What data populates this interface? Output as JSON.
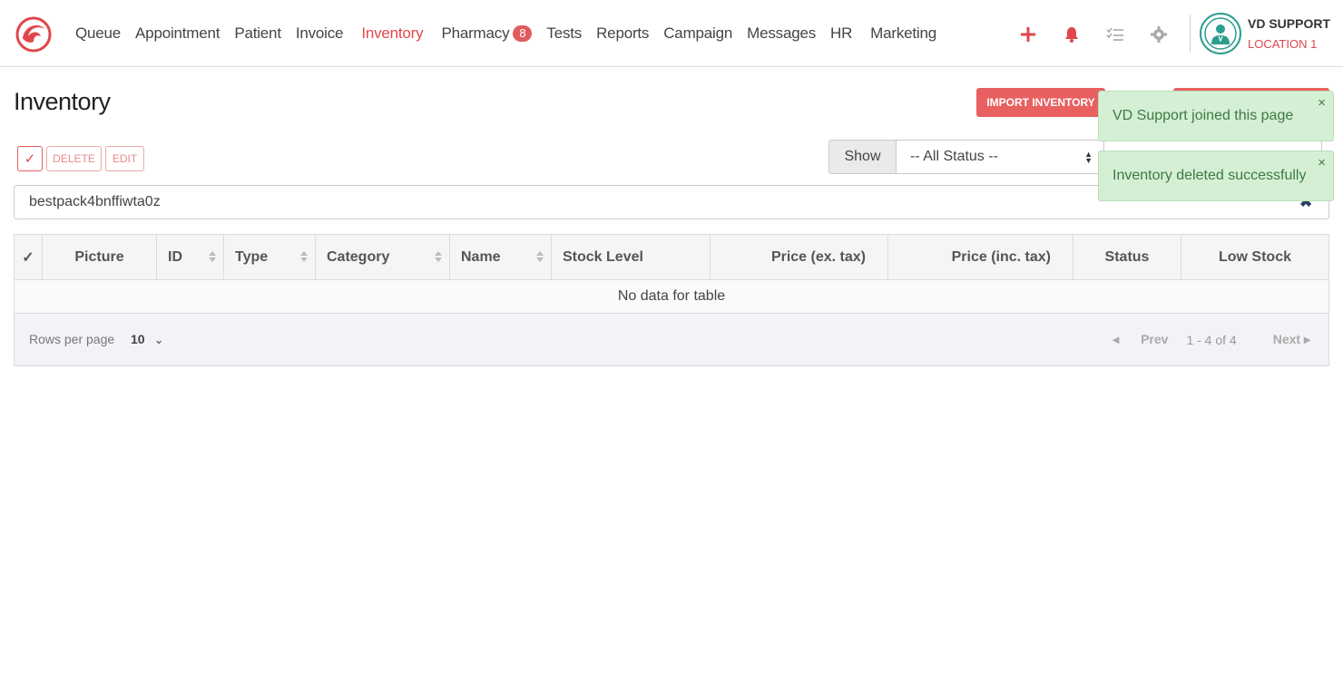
{
  "nav": {
    "items": [
      {
        "label": "Queue"
      },
      {
        "label": "Appointment"
      },
      {
        "label": "Patient"
      },
      {
        "label": "Invoice"
      },
      {
        "label": "Inventory",
        "active": true
      },
      {
        "label": "Pharmacy",
        "badge": "8"
      },
      {
        "label": "Tests"
      },
      {
        "label": "Reports"
      },
      {
        "label": "Campaign"
      },
      {
        "label": "Messages"
      },
      {
        "label": "HR"
      },
      {
        "label": "Marketing"
      }
    ],
    "icons": [
      "plus-icon",
      "bell-icon",
      "checklist-icon",
      "gear-icon"
    ]
  },
  "user": {
    "name": "VD SUPPORT",
    "location": "LOCATION 1"
  },
  "page": {
    "title": "Inventory",
    "import_label": "IMPORT INVENTORY"
  },
  "actions": {
    "check": "✓",
    "delete_label": "DELETE",
    "edit_label": "EDIT"
  },
  "filter": {
    "show_label": "Show",
    "status_selected": "-- All Status --"
  },
  "search": {
    "value": "bestpack4bnffiwta0z",
    "clear": "✖"
  },
  "table": {
    "check_header": "✓",
    "columns": [
      "Picture",
      "ID",
      "Type",
      "Category",
      "Name",
      "Stock Level",
      "Price (ex. tax)",
      "Price (inc. tax)",
      "Status",
      "Low Stock"
    ],
    "empty_text": "No data for table"
  },
  "footer": {
    "rows_label": "Rows per page",
    "rows_value": "10",
    "prev_label": "Prev",
    "range": "1 - 4 of 4",
    "next_label": "Next"
  },
  "toasts": [
    {
      "message": "VD Support joined this page"
    },
    {
      "message": "Inventory deleted successfully"
    }
  ],
  "colors": {
    "accent": "#e0474c",
    "toast_bg": "#d5efd4",
    "toast_text": "#3d7a45",
    "avatar_ring": "#2a9d8f"
  }
}
